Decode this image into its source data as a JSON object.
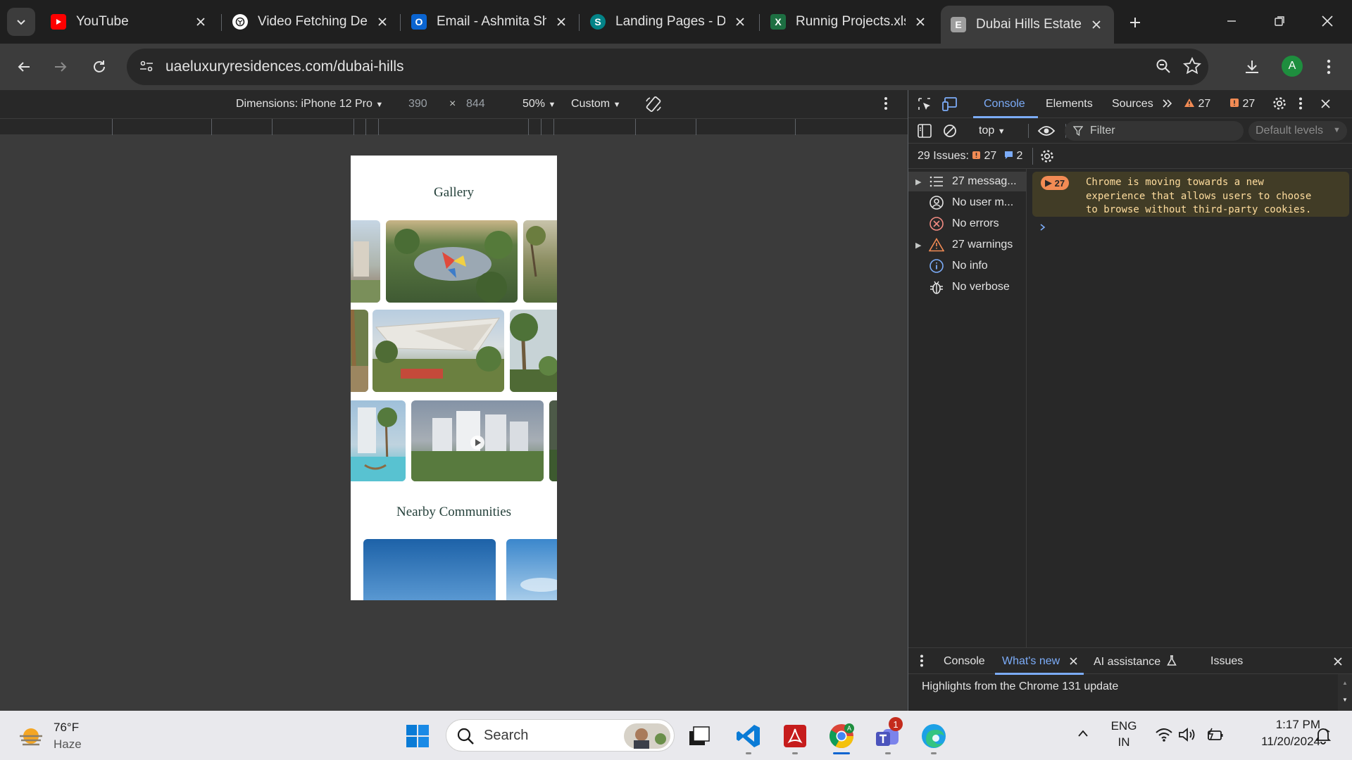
{
  "tabs": [
    {
      "title": "YouTube",
      "icon": "youtube-icon",
      "color": "#ff0000"
    },
    {
      "title": "Video Fetching De",
      "icon": "chatgpt-icon",
      "color": "#ffffff"
    },
    {
      "title": "Email - Ashmita Sh",
      "icon": "outlook-icon",
      "color": "#0a64d0"
    },
    {
      "title": "Landing Pages - D",
      "icon": "sharepoint-icon",
      "color": "#038387"
    },
    {
      "title": "Runnig Projects.xls",
      "icon": "excel-icon",
      "color": "#1d6f42"
    },
    {
      "title": "Dubai Hills Estate",
      "icon": "site-e-icon",
      "color": "#9e9e9e",
      "fav_letter": "E"
    }
  ],
  "address": {
    "url": "uaeluxuryresidences.com/dubai-hills"
  },
  "profile": {
    "initial": "A"
  },
  "device_toolbar": {
    "dimensions": "Dimensions: iPhone 12 Pro",
    "width": "390",
    "times": "×",
    "height": "844",
    "zoom": "50%",
    "throttle": "Custom"
  },
  "page": {
    "gallery_title": "Gallery",
    "nearby_title": "Nearby Communities"
  },
  "devtools": {
    "tabs": {
      "console": "Console",
      "elements": "Elements",
      "sources": "Sources",
      "warn_count": "27",
      "issue_count": "27"
    },
    "context": "top",
    "filter_placeholder": "Filter",
    "levels": "Default levels",
    "issues_label": "29 Issues:",
    "issues_warn": "27",
    "issues_info": "2",
    "sidebar": [
      {
        "label": "27 messag...",
        "icon": "list-icon",
        "expandable": true
      },
      {
        "label": "No user m...",
        "icon": "user-icon",
        "expandable": false
      },
      {
        "label": "No errors",
        "icon": "error-icon",
        "expandable": false
      },
      {
        "label": "27 warnings",
        "icon": "warning-icon",
        "expandable": true
      },
      {
        "label": "No info",
        "icon": "info-icon",
        "expandable": false
      },
      {
        "label": "No verbose",
        "icon": "bug-icon",
        "expandable": false
      }
    ],
    "message": {
      "count": "27",
      "text": "Chrome is moving towards a new\nexperience that allows users to choose\nto browse without third-party cookies."
    },
    "drawer_tabs": {
      "console": "Console",
      "whats_new": "What's new",
      "ai": "AI assistance",
      "issues": "Issues"
    },
    "drawer_text": "Highlights from the Chrome 131 update"
  },
  "taskbar": {
    "weather_temp": "76°F",
    "weather_desc": "Haze",
    "search": "Search",
    "lang1": "ENG",
    "lang2": "IN",
    "time": "1:17 PM",
    "date": "11/20/2024",
    "teams_badge": "1"
  }
}
